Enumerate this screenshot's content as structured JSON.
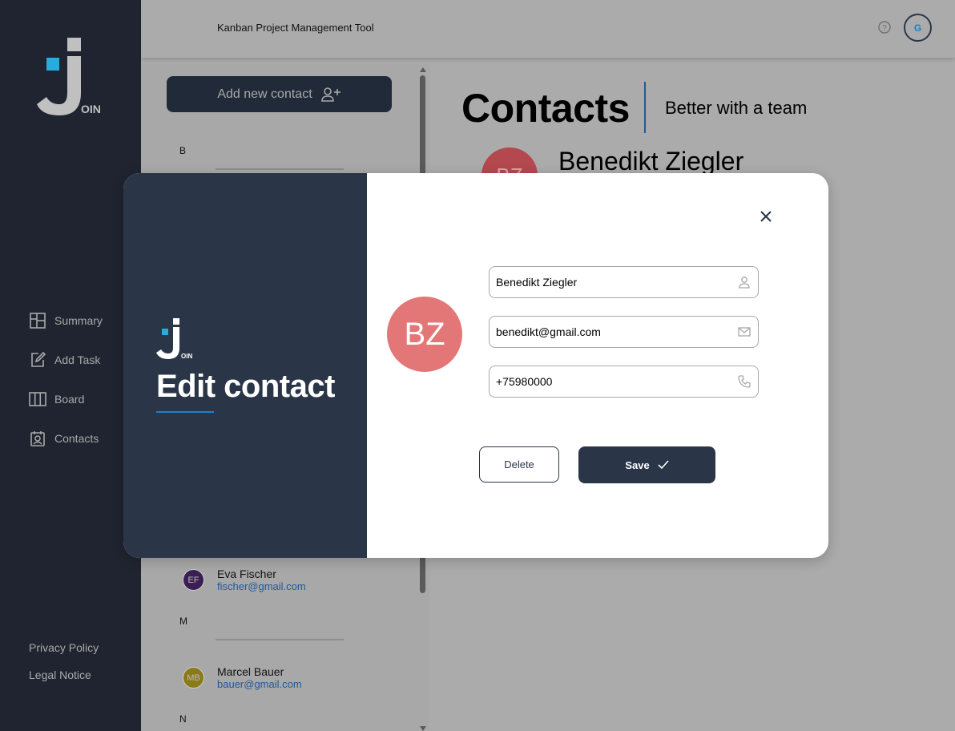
{
  "header": {
    "title": "Kanban Project Management Tool",
    "user_initial": "G"
  },
  "sidebar": {
    "logo_text": "OIN",
    "items": [
      {
        "label": "Summary",
        "icon": "summary-icon"
      },
      {
        "label": "Add Task",
        "icon": "add-task-icon"
      },
      {
        "label": "Board",
        "icon": "board-icon"
      },
      {
        "label": "Contacts",
        "icon": "contacts-icon"
      }
    ],
    "legal": [
      "Privacy Policy",
      "Legal Notice"
    ]
  },
  "contact_list": {
    "add_button_label": "Add new contact",
    "groups": [
      {
        "letter": "B"
      },
      {
        "letter": "M"
      },
      {
        "letter": "N"
      }
    ],
    "contacts": [
      {
        "initials": "EF",
        "name": "Eva Fischer",
        "email": "fischer@gmail.com",
        "color": "#3a1f54"
      },
      {
        "initials": "MB",
        "name": "Marcel Bauer",
        "email": "bauer@gmail.com",
        "color": "#8a7a1a"
      }
    ]
  },
  "main": {
    "title": "Contacts",
    "subtitle": "Better with a team",
    "selected_initials": "BZ",
    "selected_name": "Benedikt Ziegler"
  },
  "modal": {
    "logo_text": "OIN",
    "heading": "Edit contact",
    "avatar_initials": "BZ",
    "avatar_color": "#e37777",
    "fields": {
      "name": "Benedikt Ziegler",
      "email": "benedikt@gmail.com",
      "phone": "+75980000"
    },
    "delete_label": "Delete",
    "save_label": "Save"
  },
  "colors": {
    "sidebar": "#1f2430",
    "primary": "#2a3647",
    "accent": "#29abe2",
    "link": "#1c5a9c"
  }
}
